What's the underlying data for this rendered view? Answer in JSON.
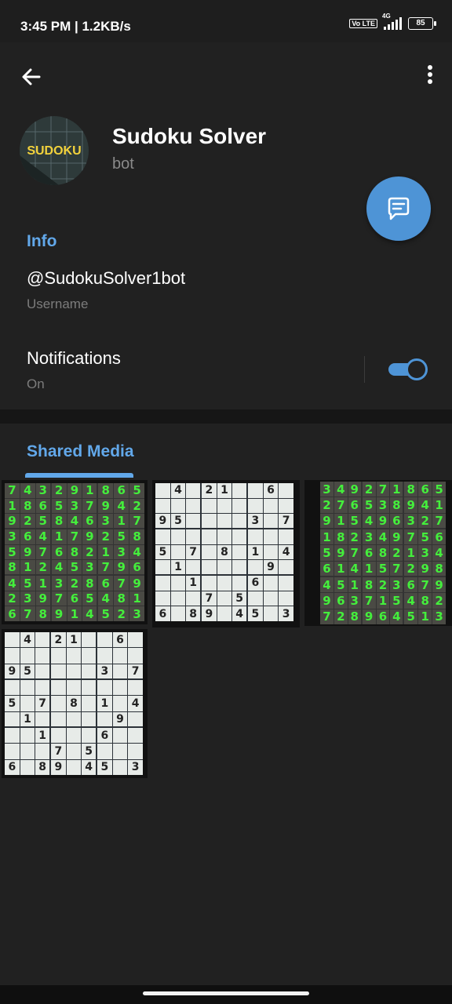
{
  "status_bar": {
    "time": "3:45 PM | 1.2KB/s",
    "volte": "Vo LTE",
    "network": "4G",
    "battery": "85"
  },
  "profile": {
    "name": "Sudoku Solver",
    "subtitle": "bot",
    "avatar_text": "SUDOKU"
  },
  "info": {
    "section_title": "Info",
    "username": "@SudokuSolver1bot",
    "username_label": "Username",
    "notifications_label": "Notifications",
    "notifications_state": "On",
    "notifications_enabled": true
  },
  "shared_media": {
    "tab_label": "Shared Media",
    "thumbnails": [
      {
        "style": "solved",
        "rows": [
          "743291865",
          "186537942",
          "925846317",
          "364179258",
          "597682134",
          "812453796",
          "451328679",
          "239765481",
          "678914523"
        ]
      },
      {
        "style": "puzzle",
        "rows": [
          " 4 21  6 ",
          "         ",
          "95    3 7",
          "         ",
          "5 7 8 1 4",
          " 1     9 ",
          "  1   6  ",
          "   7 5   ",
          "6 89 45 3"
        ]
      },
      {
        "style": "solved",
        "rows": [
          "349271865",
          "276538941",
          "915496327",
          "182349756",
          "597682134",
          "614157298",
          "451823679",
          "963715482",
          "728964513"
        ]
      },
      {
        "style": "puzzle",
        "rows": [
          " 4 21  6 ",
          "         ",
          "95    3 7",
          "         ",
          "5 7 8 1 4",
          " 1     9 ",
          "  1   6  ",
          "   7 5   ",
          "6 89 45 3"
        ]
      }
    ]
  },
  "colors": {
    "accent": "#4e94d6",
    "section_title": "#62a8ea",
    "background": "#212121"
  },
  "icons": {
    "back": "arrow-left-icon",
    "menu": "more-vert-icon",
    "fab": "message-icon"
  }
}
